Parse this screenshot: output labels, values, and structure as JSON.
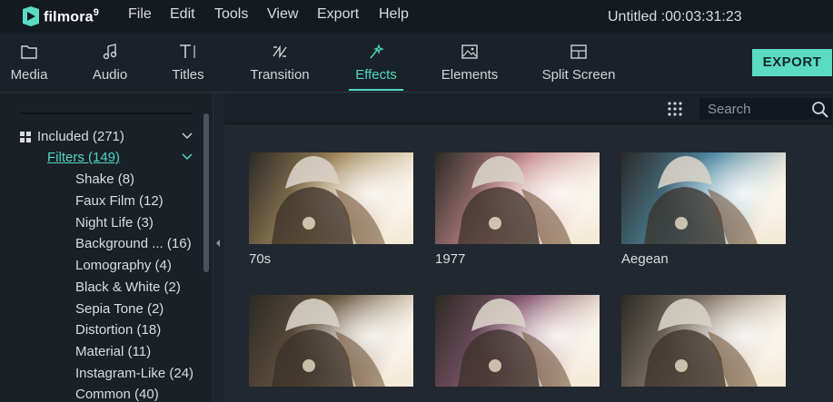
{
  "app": {
    "logo_text": "filmora",
    "logo_version": "9",
    "project_title": "Untitled :00:03:31:23"
  },
  "menu": [
    "File",
    "Edit",
    "Tools",
    "View",
    "Export",
    "Help"
  ],
  "tabs": [
    {
      "label": "Media",
      "icon": "folder-icon"
    },
    {
      "label": "Audio",
      "icon": "music-note-icon"
    },
    {
      "label": "Titles",
      "icon": "text-icon"
    },
    {
      "label": "Transition",
      "icon": "transition-icon"
    },
    {
      "label": "Effects",
      "icon": "effects-icon",
      "active": true
    },
    {
      "label": "Elements",
      "icon": "image-icon"
    },
    {
      "label": "Split Screen",
      "icon": "split-screen-icon"
    }
  ],
  "export_label": "EXPORT",
  "sidebar": {
    "category": "Included (271)",
    "filters": "Filters (149)",
    "items": [
      "Shake (8)",
      "Faux Film (12)",
      "Night Life (3)",
      "Background ... (16)",
      "Lomography (4)",
      "Black & White (2)",
      "Sepia Tone (2)",
      "Distortion (18)",
      "Material (11)",
      "Instagram-Like (24)",
      "Common (40)"
    ]
  },
  "search": {
    "placeholder": "Search",
    "value": ""
  },
  "effects": [
    {
      "name": "70s",
      "tint": "#a58a5c"
    },
    {
      "name": "1977",
      "tint": "#c88a8e"
    },
    {
      "name": "Aegean",
      "tint": "#4f8aa5"
    },
    {
      "name": "",
      "tint": "#6a5840"
    },
    {
      "name": "",
      "tint": "#8a5a72"
    },
    {
      "name": "",
      "tint": "#8d8070"
    }
  ],
  "colors": {
    "accent": "#4fd7c2",
    "export_bg": "#5bdbc4",
    "background": "#1e242b"
  }
}
